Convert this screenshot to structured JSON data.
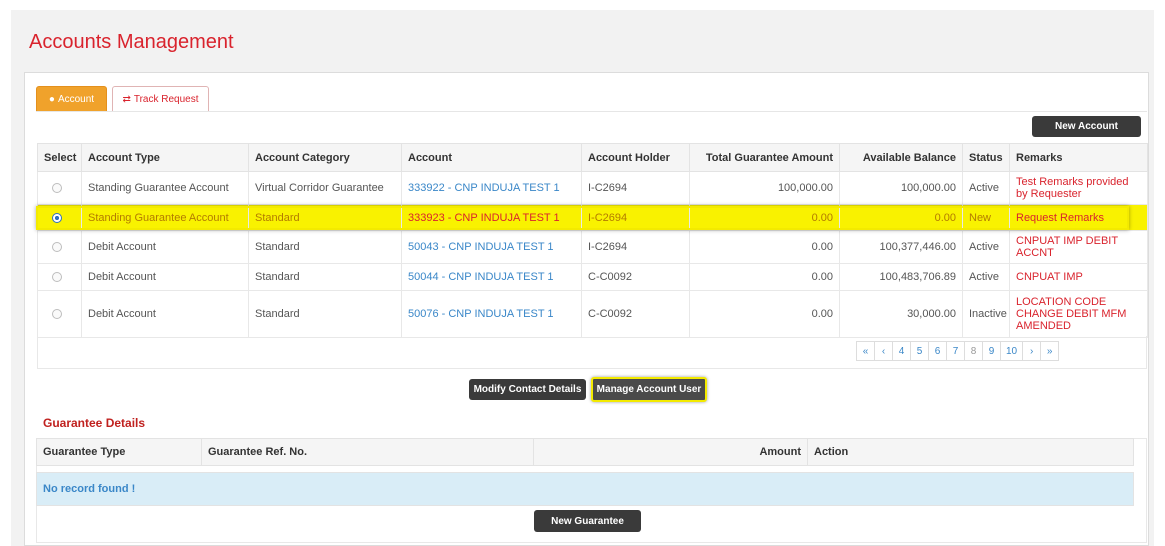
{
  "page": {
    "title": "Accounts Management"
  },
  "tabs": [
    {
      "label": "Account",
      "icon": "circle-icon",
      "active": true
    },
    {
      "label": "Track Request",
      "icon": "exchange-icon",
      "active": false
    }
  ],
  "buttons": {
    "new_account": "New Account",
    "modify_contact": "Modify Contact Details",
    "manage_user": "Manage Account User",
    "new_guarantee": "New Guarantee"
  },
  "accounts": {
    "headers": [
      "Select",
      "Account Type",
      "Account Category",
      "Account",
      "Account Holder",
      "Total Guarantee Amount",
      "Available Balance",
      "Status",
      "Remarks"
    ],
    "rows": [
      {
        "selected": false,
        "type": "Standing Guarantee Account",
        "category": "Virtual Corridor Guarantee",
        "account": "333922 - CNP INDUJA TEST 1",
        "holder": "I-C2694",
        "total": "100,000.00",
        "balance": "100,000.00",
        "status": "Active",
        "remarks": "Test Remarks provided by Requester"
      },
      {
        "selected": true,
        "type": "Standing Guarantee Account",
        "category": "Standard",
        "account": "333923 - CNP INDUJA TEST 1",
        "holder": "I-C2694",
        "total": "0.00",
        "balance": "0.00",
        "status": "New",
        "remarks": "Request Remarks"
      },
      {
        "selected": false,
        "type": "Debit Account",
        "category": "Standard",
        "account": "50043 - CNP INDUJA TEST 1",
        "holder": "I-C2694",
        "total": "0.00",
        "balance": "100,377,446.00",
        "status": "Active",
        "remarks": "CNPUAT IMP DEBIT ACCNT"
      },
      {
        "selected": false,
        "type": "Debit Account",
        "category": "Standard",
        "account": "50044 - CNP INDUJA TEST 1",
        "holder": "C-C0092",
        "total": "0.00",
        "balance": "100,483,706.89",
        "status": "Active",
        "remarks": "CNPUAT IMP"
      },
      {
        "selected": false,
        "type": "Debit Account",
        "category": "Standard",
        "account": "50076 - CNP INDUJA TEST 1",
        "holder": "C-C0092",
        "total": "0.00",
        "balance": "30,000.00",
        "status": "Inactive",
        "remarks": "LOCATION CODE CHANGE DEBIT MFM AMENDED"
      }
    ]
  },
  "pagination": {
    "first": "«",
    "prev": "‹",
    "pages": [
      "4",
      "5",
      "6",
      "7",
      "8",
      "9",
      "10"
    ],
    "current": "8",
    "next": "›",
    "last": "»"
  },
  "guarantee": {
    "title": "Guarantee Details",
    "headers": [
      "Guarantee Type",
      "Guarantee Ref. No.",
      "Amount",
      "Action"
    ],
    "empty_text": "No record found !"
  }
}
